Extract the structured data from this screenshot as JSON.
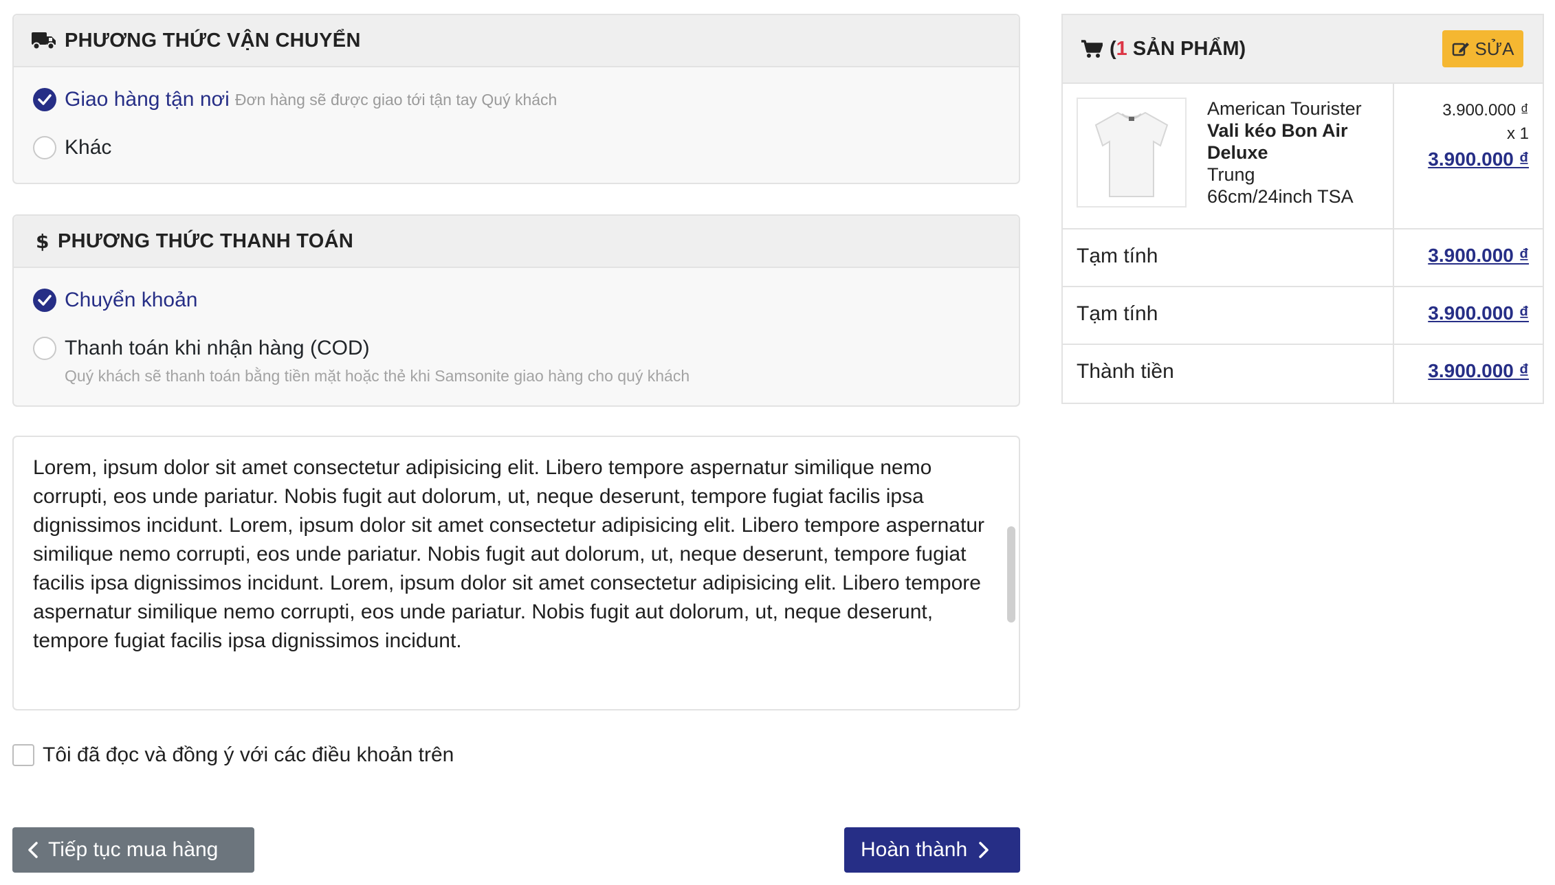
{
  "shipping": {
    "title": "PHƯƠNG THỨC VẬN CHUYỂN",
    "options": [
      {
        "label": "Giao hàng tận nơi",
        "note": "Đơn hàng sẽ được giao tới tận tay Quý khách",
        "selected": true
      },
      {
        "label": "Khác",
        "selected": false
      }
    ]
  },
  "payment": {
    "title": "PHƯƠNG THỨC THANH TOÁN",
    "options": [
      {
        "label": "Chuyển khoản",
        "selected": true
      },
      {
        "label": "Thanh toán khi nhận hàng (COD)",
        "note": "Quý khách sẽ thanh toán bằng tiền mặt hoặc thẻ khi Samsonite giao hàng cho quý khách",
        "selected": false
      }
    ]
  },
  "terms": {
    "text": "Lorem, ipsum dolor sit amet consectetur adipisicing elit. Libero tempore aspernatur similique nemo corrupti, eos unde pariatur. Nobis fugit aut dolorum, ut, neque deserunt, tempore fugiat facilis ipsa dignissimos incidunt. Lorem, ipsum dolor sit amet consectetur adipisicing elit. Libero tempore aspernatur similique nemo corrupti, eos unde pariatur. Nobis fugit aut dolorum, ut, neque deserunt, tempore fugiat facilis ipsa dignissimos incidunt. Lorem, ipsum dolor sit amet consectetur adipisicing elit. Libero tempore aspernatur similique nemo corrupti, eos unde pariatur. Nobis fugit aut dolorum, ut, neque deserunt, tempore fugiat facilis ipsa dignissimos incidunt.",
    "agree_label": "Tôi đã đọc và đồng ý với các điều khoản trên",
    "agreed": false
  },
  "buttons": {
    "back": "Tiếp tục mua hàng",
    "done": "Hoàn thành"
  },
  "cart": {
    "title_open": "(",
    "count": "1",
    "title_rest": " SẢN PHẨM)",
    "edit_label": "SỬA",
    "product": {
      "brand": "American Tourister",
      "name": "Vali kéo Bon Air Deluxe",
      "size_label": "Trung",
      "variant": "66cm/24inch TSA",
      "unit_price": "3.900.000 ₫",
      "qty": "x 1",
      "total": "3.900.000 ₫"
    },
    "summary": [
      {
        "label": "Tạm tính",
        "value": "3.900.000 ₫"
      },
      {
        "label": "Tạm tính",
        "value": "3.900.000 ₫"
      },
      {
        "label": "Thành tiền",
        "value": "3.900.000 ₫"
      }
    ]
  },
  "colors": {
    "primary": "#262e86",
    "secondary": "#6c757d",
    "warning": "#f5b731",
    "danger": "#dc3545"
  },
  "icons": [
    "truck-icon",
    "dollar-icon",
    "cart-icon",
    "edit-icon",
    "chevron-left-icon",
    "chevron-right-icon",
    "check-icon"
  ]
}
